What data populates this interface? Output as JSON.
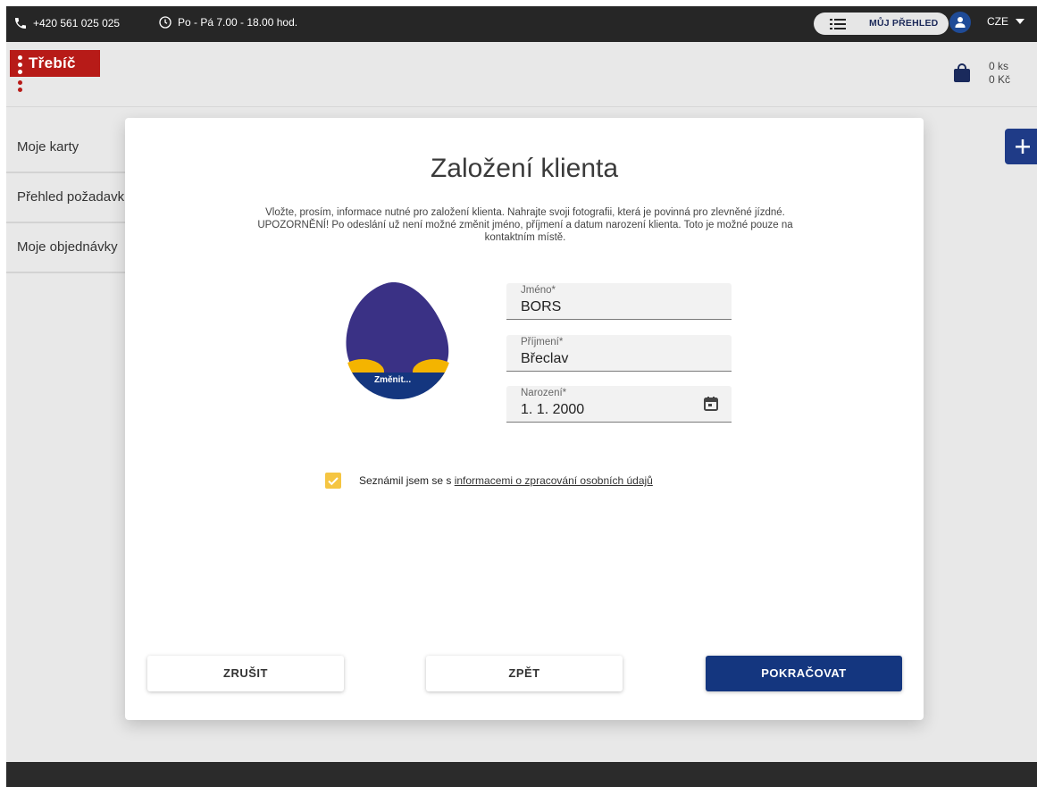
{
  "topbar": {
    "phone": "+420 561 025 025",
    "hours": "Po - Pá 7.00 - 18.00 hod.",
    "overview_label": "MŮJ PŘEHLED",
    "language": "CZE"
  },
  "header": {
    "logo_text": "Třebíč",
    "cart_count": "0 ks",
    "cart_price": "0 Kč"
  },
  "sidebar": {
    "items": [
      {
        "label": "Moje karty"
      },
      {
        "label": "Přehled požadavků"
      },
      {
        "label": "Moje objednávky"
      }
    ]
  },
  "modal": {
    "title": "Založení klienta",
    "description": "Vložte, prosím, informace nutné pro založení klienta. Nahrajte svoji fotografii, která je povinná pro zlevněné jízdné. UPOZORNĚNÍ! Po odeslání už není možné změnit jméno, příjmení a datum narození klienta. Toto je možné pouze na kontaktním místě.",
    "photo_change": "Změnit...",
    "fields": {
      "first_name": {
        "label": "Jméno*",
        "value": "BORS"
      },
      "last_name": {
        "label": "Příjmení*",
        "value": "Břeclav"
      },
      "birth_date": {
        "label": "Narození*",
        "value": "1. 1. 2000"
      }
    },
    "consent_text": "Seznámil jsem se s ",
    "consent_link": "informacemi o zpracování osobních údajů",
    "consent_checked": true,
    "buttons": {
      "cancel": "ZRUŠIT",
      "back": "ZPĚT",
      "continue": "POKRAČOVAT"
    }
  },
  "colors": {
    "primary": "#14367f",
    "accent": "#f5c542",
    "logo_red": "#b71b18",
    "avatar_purple": "#3a3185"
  }
}
